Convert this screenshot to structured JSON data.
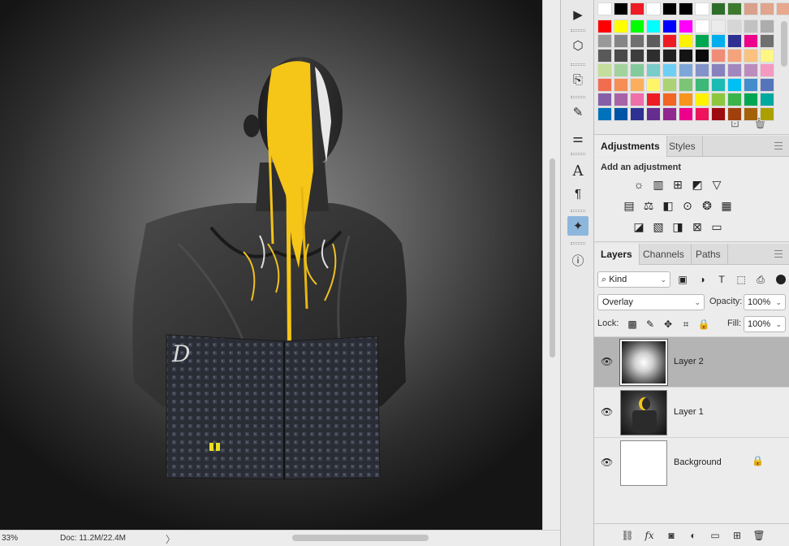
{
  "status": {
    "zoom": "33%",
    "doc": "Doc: 11.2M/22.4M",
    "arrow": "〉"
  },
  "canvas_art": {
    "tablet_glyph": "D",
    "colors": {
      "paint": "#f5c518",
      "skin": "#2b2b2b",
      "cloth": "#3a3a3a",
      "tablet": "#2c2f38"
    }
  },
  "tools": [
    {
      "name": "play-icon",
      "glyph": "▶"
    },
    {
      "name": "3d-object-icon",
      "glyph": "⬡"
    },
    {
      "name": "transform-icon",
      "glyph": "⎘"
    },
    {
      "name": "brush-settings-icon",
      "glyph": "✎"
    },
    {
      "name": "sliders-icon",
      "glyph": "⚌"
    },
    {
      "name": "character-icon",
      "glyph": "A"
    },
    {
      "name": "paragraph-icon",
      "glyph": "¶"
    },
    {
      "name": "plugin-icon",
      "glyph": "✦"
    },
    {
      "name": "info-icon",
      "glyph": "ⓘ"
    }
  ],
  "swatches": {
    "top_row": [
      "#ffffff",
      "#000000",
      "#ed1c24",
      "#ffffff",
      "#000000",
      "#000000",
      "#ffffff",
      "#2d6e2b",
      "#3d7a2d",
      "#d9a08b",
      "#e0a58c",
      "#e7a88e",
      "#f0b49a"
    ],
    "rows": [
      [
        "#ff0000",
        "#ffff00",
        "#00ff00",
        "#00ffff",
        "#0000ff",
        "#ff00ff",
        "#ffffff",
        "#ebebeb",
        "#d6d6d6",
        "#c2c2c2",
        "#adadad"
      ],
      [
        "#999999",
        "#858585",
        "#707070",
        "#5c5c5c",
        "#ed1c24",
        "#fff200",
        "#00a651",
        "#00aeef",
        "#2e3192",
        "#ec008c",
        "#707070"
      ],
      [
        "#595959",
        "#4a4a4a",
        "#3d3d3d",
        "#2e2e2e",
        "#1f1f1f",
        "#141414",
        "#0a0a0a",
        "#f08c78",
        "#f5a37a",
        "#fbc17f",
        "#fff685"
      ],
      [
        "#c4df9b",
        "#a2d39c",
        "#82ca9c",
        "#7accc8",
        "#6dcff6",
        "#7da7d9",
        "#8393ca",
        "#8781bd",
        "#a187be",
        "#bd8cbf",
        "#f49ac1"
      ],
      [
        "#f26c4f",
        "#f68e56",
        "#fbaf5d",
        "#fff568",
        "#acd373",
        "#7cc576",
        "#3cb878",
        "#1cbbb4",
        "#00bff3",
        "#448ccb",
        "#5674b9"
      ],
      [
        "#8560a8",
        "#a863a8",
        "#f06eaa",
        "#ed1c24",
        "#f26522",
        "#f7941d",
        "#fff200",
        "#8dc73f",
        "#39b54a",
        "#00a651",
        "#00a99d"
      ],
      [
        "#0072bc",
        "#0054a6",
        "#2e3192",
        "#662d91",
        "#92278f",
        "#ec008c",
        "#ed145b",
        "#9e0b0f",
        "#a0410d",
        "#a36209",
        "#aba000"
      ]
    ]
  },
  "adjustments": {
    "tabs": [
      "Adjustments",
      "Styles"
    ],
    "title": "Add an adjustment",
    "row1": [
      {
        "name": "brightness-contrast-icon",
        "glyph": "☼"
      },
      {
        "name": "levels-icon",
        "glyph": "▥"
      },
      {
        "name": "curves-icon",
        "glyph": "⊞"
      },
      {
        "name": "exposure-icon",
        "glyph": "◩"
      },
      {
        "name": "vibrance-icon",
        "glyph": "▽"
      }
    ],
    "row2": [
      {
        "name": "hue-saturation-icon",
        "glyph": "▤"
      },
      {
        "name": "color-balance-icon",
        "glyph": "⚖"
      },
      {
        "name": "black-white-icon",
        "glyph": "◧"
      },
      {
        "name": "photo-filter-icon",
        "glyph": "⊙"
      },
      {
        "name": "channel-mixer-icon",
        "glyph": "❂"
      },
      {
        "name": "color-lookup-icon",
        "glyph": "▦"
      }
    ],
    "row3": [
      {
        "name": "invert-icon",
        "glyph": "◪"
      },
      {
        "name": "posterize-icon",
        "glyph": "▧"
      },
      {
        "name": "threshold-icon",
        "glyph": "◨"
      },
      {
        "name": "selective-color-icon",
        "glyph": "⊠"
      },
      {
        "name": "gradient-map-icon",
        "glyph": "▭"
      }
    ]
  },
  "layers_panel": {
    "tabs": [
      "Layers",
      "Channels",
      "Paths"
    ],
    "kind": "Kind",
    "kind_icon": "⌕",
    "filter_icons": [
      {
        "name": "pixel-filter-icon",
        "glyph": "▣"
      },
      {
        "name": "adjustment-filter-icon",
        "glyph": "◑"
      },
      {
        "name": "type-filter-icon",
        "glyph": "T"
      },
      {
        "name": "shape-filter-icon",
        "glyph": "⬚"
      },
      {
        "name": "smart-object-filter-icon",
        "glyph": "⎙"
      }
    ],
    "blend_mode": "Overlay",
    "opacity_label": "Opacity:",
    "opacity": "100%",
    "lock_label": "Lock:",
    "lock_icons": [
      {
        "name": "lock-transparent-icon",
        "glyph": "▩"
      },
      {
        "name": "lock-paint-icon",
        "glyph": "✎"
      },
      {
        "name": "lock-position-icon",
        "glyph": "✥"
      },
      {
        "name": "lock-artboard-icon",
        "glyph": "⌗"
      },
      {
        "name": "lock-all-icon",
        "glyph": "🔒"
      }
    ],
    "fill_label": "Fill:",
    "fill": "100%",
    "layers": [
      {
        "name": "Layer 2",
        "visible": true,
        "selected": true,
        "locked": false,
        "thumb": "radial"
      },
      {
        "name": "Layer 1",
        "visible": true,
        "selected": false,
        "locked": false,
        "thumb": "photo"
      },
      {
        "name": "Background",
        "visible": true,
        "selected": false,
        "locked": true,
        "thumb": "white"
      }
    ],
    "footer_icons": [
      {
        "name": "link-layers-icon",
        "glyph": "⛓"
      },
      {
        "name": "layer-style-icon",
        "glyph": "fx"
      },
      {
        "name": "layer-mask-icon",
        "glyph": "◙"
      },
      {
        "name": "new-fill-adjustment-icon",
        "glyph": "◐"
      },
      {
        "name": "new-group-icon",
        "glyph": "▭"
      },
      {
        "name": "new-layer-icon",
        "glyph": "⊞"
      },
      {
        "name": "delete-layer-icon",
        "glyph": "🗑"
      }
    ]
  },
  "swatch_footer_icons": [
    {
      "name": "new-swatch-icon",
      "glyph": "⊡"
    },
    {
      "name": "delete-swatch-icon",
      "glyph": "🗑"
    }
  ],
  "eye_glyph": "👁",
  "lock_glyph": "🔒"
}
